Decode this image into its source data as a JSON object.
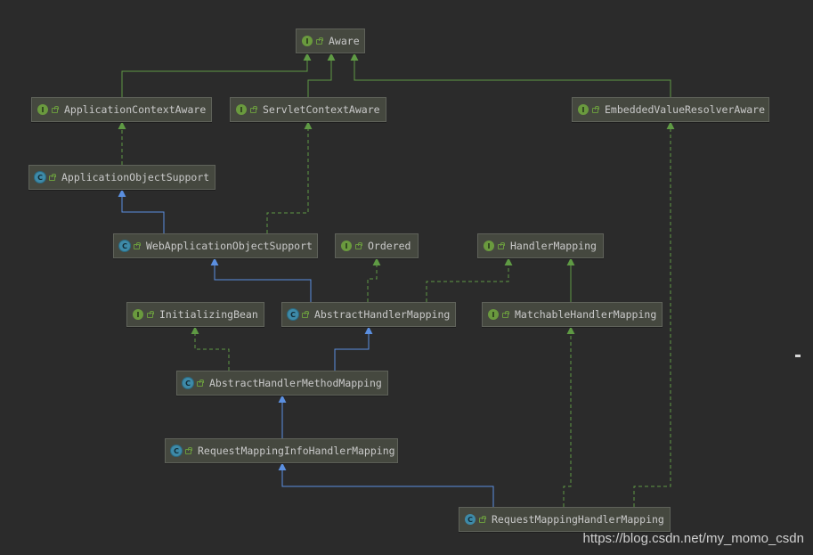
{
  "colors": {
    "background": "#2b2b2b",
    "implements_edge": "#5f9a44",
    "extends_edge": "#5b8fe0",
    "interface_badge": "#6a9a3e",
    "class_badge": "#3e8aa8"
  },
  "nodes": [
    {
      "id": "aware",
      "label": "Aware",
      "kind": "interface",
      "badge": "I"
    },
    {
      "id": "appctx",
      "label": "ApplicationContextAware",
      "kind": "interface",
      "badge": "I"
    },
    {
      "id": "servletctx",
      "label": "ServletContextAware",
      "kind": "interface",
      "badge": "I"
    },
    {
      "id": "embedded",
      "label": "EmbeddedValueResolverAware",
      "kind": "interface",
      "badge": "I"
    },
    {
      "id": "appobj",
      "label": "ApplicationObjectSupport",
      "kind": "abstract-class",
      "badge": "C"
    },
    {
      "id": "webappobj",
      "label": "WebApplicationObjectSupport",
      "kind": "abstract-class",
      "badge": "C"
    },
    {
      "id": "ordered",
      "label": "Ordered",
      "kind": "interface",
      "badge": "I"
    },
    {
      "id": "handlermapping",
      "label": "HandlerMapping",
      "kind": "interface",
      "badge": "I"
    },
    {
      "id": "initbean",
      "label": "InitializingBean",
      "kind": "interface",
      "badge": "I"
    },
    {
      "id": "abshandler",
      "label": "AbstractHandlerMapping",
      "kind": "abstract-class",
      "badge": "C"
    },
    {
      "id": "matchable",
      "label": "MatchableHandlerMapping",
      "kind": "interface",
      "badge": "I"
    },
    {
      "id": "abshandlermethod",
      "label": "AbstractHandlerMethodMapping",
      "kind": "abstract-class",
      "badge": "C"
    },
    {
      "id": "reqinfo",
      "label": "RequestMappingInfoHandlerMapping",
      "kind": "abstract-class",
      "badge": "C"
    },
    {
      "id": "reqmapping",
      "label": "RequestMappingHandlerMapping",
      "kind": "class",
      "badge": "C"
    }
  ],
  "edges": [
    {
      "from": "appctx",
      "to": "aware",
      "type": "interface-extends"
    },
    {
      "from": "servletctx",
      "to": "aware",
      "type": "interface-extends"
    },
    {
      "from": "embedded",
      "to": "aware",
      "type": "interface-extends"
    },
    {
      "from": "appobj",
      "to": "appctx",
      "type": "implements"
    },
    {
      "from": "webappobj",
      "to": "appobj",
      "type": "extends"
    },
    {
      "from": "webappobj",
      "to": "servletctx",
      "type": "implements"
    },
    {
      "from": "abshandler",
      "to": "webappobj",
      "type": "extends"
    },
    {
      "from": "abshandler",
      "to": "ordered",
      "type": "implements"
    },
    {
      "from": "abshandler",
      "to": "handlermapping",
      "type": "implements"
    },
    {
      "from": "matchable",
      "to": "handlermapping",
      "type": "interface-extends"
    },
    {
      "from": "abshandlermethod",
      "to": "initbean",
      "type": "implements"
    },
    {
      "from": "abshandlermethod",
      "to": "abshandler",
      "type": "extends"
    },
    {
      "from": "reqinfo",
      "to": "abshandlermethod",
      "type": "extends"
    },
    {
      "from": "reqmapping",
      "to": "reqinfo",
      "type": "extends"
    },
    {
      "from": "reqmapping",
      "to": "matchable",
      "type": "implements"
    },
    {
      "from": "reqmapping",
      "to": "embedded",
      "type": "implements"
    }
  ],
  "watermark": "https://blog.csdn.net/my_momo_csdn"
}
